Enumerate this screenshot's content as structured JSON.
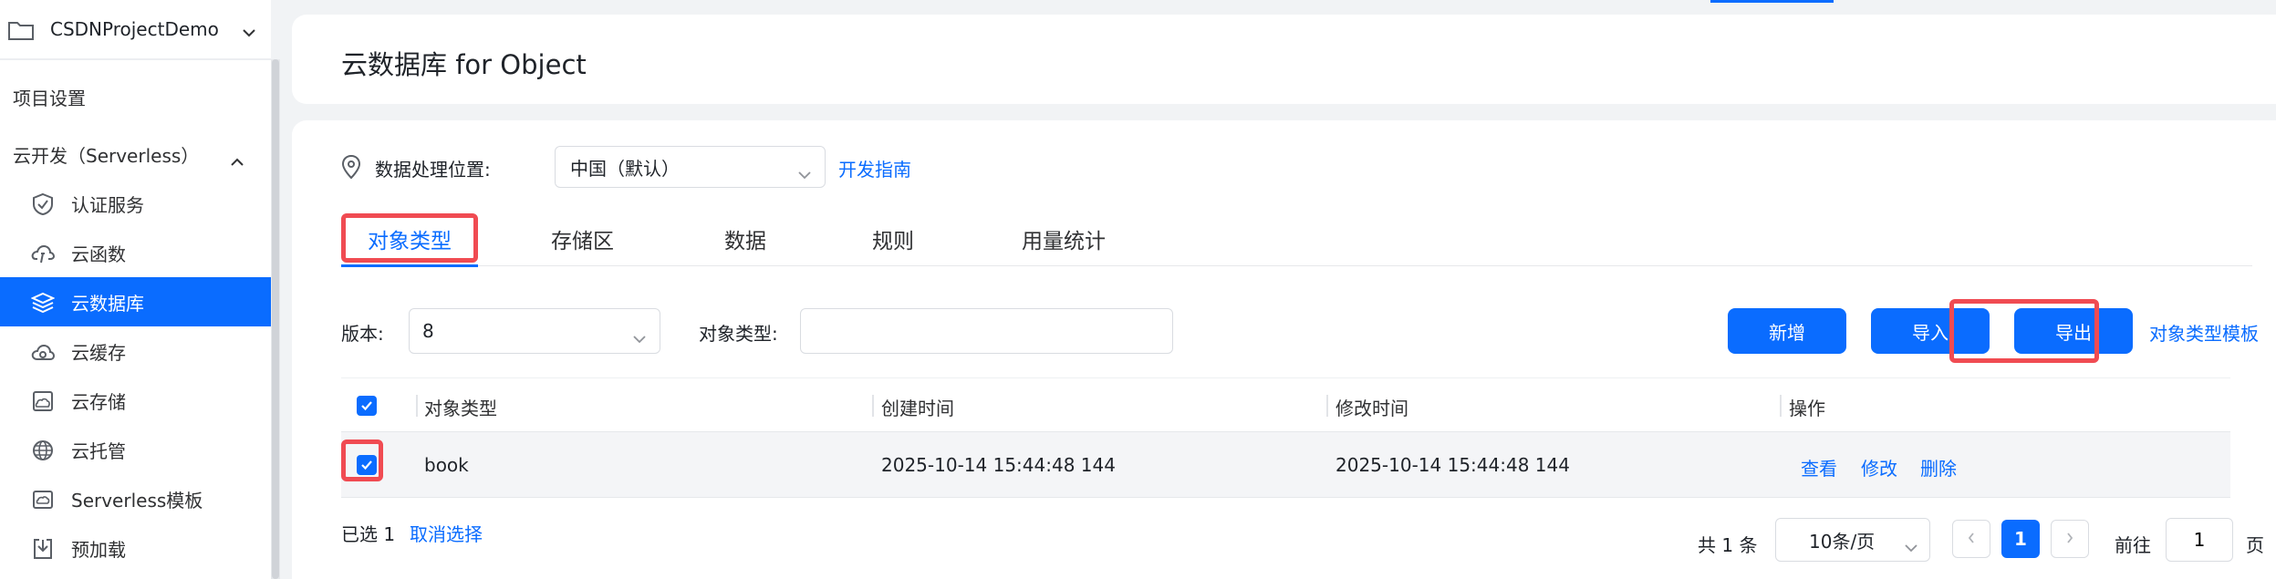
{
  "sidebar": {
    "project_name": "CSDNProjectDemo",
    "project_settings": "项目设置",
    "serverless_group": "云开发（Serverless）",
    "items": [
      {
        "label": "认证服务",
        "icon": "shield-check-icon"
      },
      {
        "label": "云函数",
        "icon": "cloud-function-icon"
      },
      {
        "label": "云数据库",
        "icon": "database-stack-icon"
      },
      {
        "label": "云缓存",
        "icon": "cloud-cache-icon"
      },
      {
        "label": "云存储",
        "icon": "cloud-storage-icon"
      },
      {
        "label": "云托管",
        "icon": "globe-icon"
      },
      {
        "label": "Serverless模板",
        "icon": "template-icon"
      },
      {
        "label": "预加载",
        "icon": "preload-icon"
      }
    ],
    "active_index": 2
  },
  "header": {
    "title": "云数据库 for Object"
  },
  "location": {
    "label": "数据处理位置:",
    "selected": "中国（默认）",
    "guide_link": "开发指南"
  },
  "tabs": [
    {
      "label": "对象类型",
      "active": true
    },
    {
      "label": "存储区",
      "active": false
    },
    {
      "label": "数据",
      "active": false
    },
    {
      "label": "规则",
      "active": false
    },
    {
      "label": "用量统计",
      "active": false
    }
  ],
  "filters": {
    "version_label": "版本:",
    "version_value": "8",
    "type_label": "对象类型:",
    "type_placeholder": ""
  },
  "actions": {
    "add": "新增",
    "import": "导入",
    "export": "导出",
    "template_link": "对象类型模板"
  },
  "table": {
    "columns": [
      "对象类型",
      "创建时间",
      "修改时间",
      "操作"
    ],
    "rows": [
      {
        "name": "book",
        "created": "2025-10-14 15:44:48 144",
        "modified": "2025-10-14 15:44:48 144",
        "ops": [
          "查看",
          "修改",
          "删除"
        ],
        "checked": true
      }
    ]
  },
  "footer": {
    "selected_text": "已选 1",
    "cancel_text": "取消选择",
    "total_text": "共 1 条",
    "page_size": "10条/页",
    "current_page": "1",
    "goto_label": "前往",
    "goto_value": "1",
    "page_unit": "页"
  },
  "colors": {
    "accent": "#0a6cff",
    "highlight": "#f04b52"
  }
}
